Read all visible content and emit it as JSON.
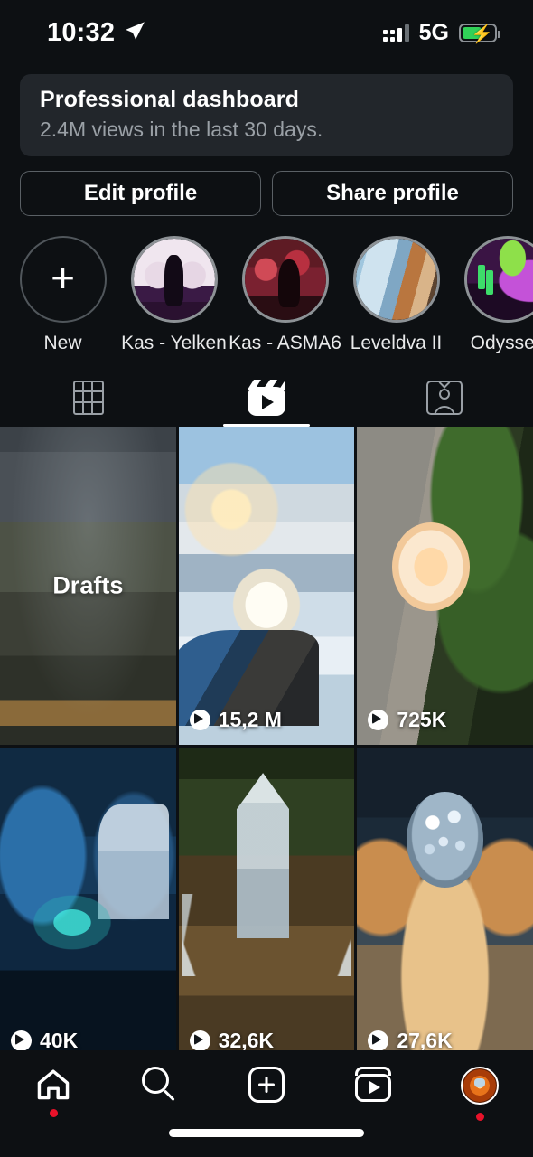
{
  "status_bar": {
    "time": "10:32",
    "location_icon": "location-arrow-icon",
    "signal_icon": "cellular-signal-icon",
    "network": "5G",
    "battery_icon": "battery-charging-icon"
  },
  "professional_dashboard": {
    "title": "Professional dashboard",
    "subtitle": "2.4M views in the last 30 days."
  },
  "profile_actions": {
    "edit_label": "Edit profile",
    "share_label": "Share profile"
  },
  "highlights": [
    {
      "label": "New",
      "icon": "plus-icon",
      "kind": "new"
    },
    {
      "label": "Kas - Yelken",
      "kind": "story",
      "art": "t-yelken"
    },
    {
      "label": "Kas - ASMA6",
      "kind": "story",
      "art": "t-asma"
    },
    {
      "label": "Leveldva II",
      "kind": "story",
      "art": "t-level"
    },
    {
      "label": "Odyssey",
      "kind": "story",
      "art": "t-odyssey"
    }
  ],
  "content_tabs": [
    {
      "name": "grid-tab",
      "icon": "grid-icon",
      "selected": false
    },
    {
      "name": "reels-tab",
      "icon": "reels-icon",
      "selected": true
    },
    {
      "name": "tagged-tab",
      "icon": "tagged-person-icon",
      "selected": false
    }
  ],
  "media_grid": [
    {
      "label": "Drafts",
      "views": "",
      "art": "a-drafts",
      "progress": 0
    },
    {
      "label": "",
      "views": "15,2 M",
      "art": "a-mountain",
      "progress": 0
    },
    {
      "label": "",
      "views": "725K",
      "art": "a-flower",
      "progress": 0
    },
    {
      "label": "",
      "views": "40K",
      "art": "a-lab",
      "progress": 0
    },
    {
      "label": "",
      "views": "32,6K",
      "art": "a-crystal",
      "progress": 100
    },
    {
      "label": "",
      "views": "27,6K",
      "art": "a-spider",
      "progress": 0
    }
  ],
  "bottom_nav": [
    {
      "name": "home",
      "icon": "home-icon",
      "badge": true
    },
    {
      "name": "search",
      "icon": "search-icon",
      "badge": false
    },
    {
      "name": "create",
      "icon": "plus-square-icon",
      "badge": false
    },
    {
      "name": "reels",
      "icon": "reels-icon",
      "badge": false
    },
    {
      "name": "profile",
      "icon": "avatar-icon",
      "badge": true
    }
  ],
  "colors": {
    "background": "#0d1013",
    "card": "#22262b",
    "accent_badge": "#e8122a",
    "battery_green": "#31d158",
    "muted_text": "#9aa0a6"
  }
}
